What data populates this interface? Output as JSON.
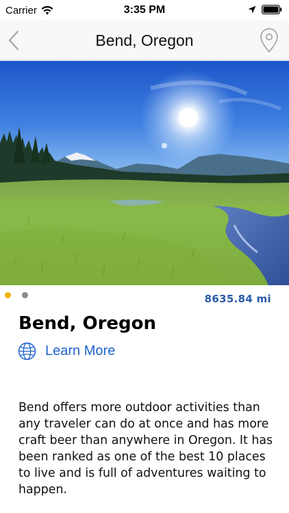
{
  "status_bar": {
    "carrier": "Carrier",
    "time": "3:35 PM"
  },
  "nav": {
    "title": "Bend, Oregon",
    "back_icon": "chevron-left-icon",
    "pin_icon": "location-pin-icon"
  },
  "hero": {
    "image": "meadow-mountain-landscape",
    "page_count": 2,
    "current_page": 1
  },
  "details": {
    "distance": "8635.84 mi",
    "title": "Bend, Oregon",
    "learn_more_label": "Learn More",
    "learn_more_icon": "globe-icon",
    "description": "Bend offers more outdoor activities than any traveler can do at once and has more craft beer than anywhere in Oregon. It has been ranked as one of the best 10 places to live and is full of adventures waiting to happen."
  },
  "colors": {
    "accent": "#1f63c9",
    "distance": "#2a5aa8",
    "pager_active": "#f0b400",
    "pager_inactive": "#8a8a8a"
  }
}
